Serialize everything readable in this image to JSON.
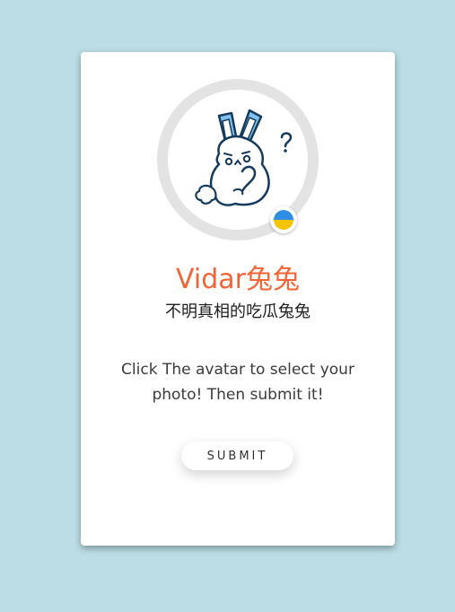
{
  "profile": {
    "name": "Vidar兔兔",
    "subtitle": "不明真相的吃瓜兔兔",
    "description": "Click The avatar to select your photo! Then submit it!"
  },
  "actions": {
    "submit_label": "SUBMIT"
  },
  "colors": {
    "background": "#bcdde5",
    "card": "#ffffff",
    "name": "#f16535",
    "avatar_ring": "#e3e3e3",
    "flag_top": "#2f8de4",
    "flag_bottom": "#f5c400"
  },
  "icons": {
    "avatar": "rabbit-avatar-icon",
    "badge": "ukraine-flag-icon"
  }
}
